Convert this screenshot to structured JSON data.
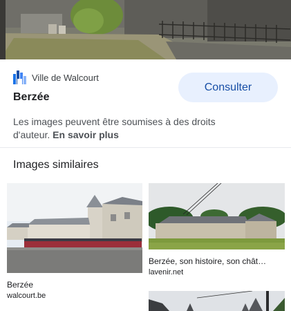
{
  "source": {
    "name": "Ville de Walcourt",
    "logo_icon": "walcourt-logo-icon",
    "brand_color": "#1a73e8"
  },
  "image": {
    "title": "Berzée",
    "consult_label": "Consulter",
    "notice_text": "Les images peuvent être soumises à des droits d'auteur.",
    "learn_more": "En savoir plus"
  },
  "similar": {
    "heading": "Images similaires",
    "items": [
      {
        "caption": "Berzée",
        "domain": "walcourt.be"
      },
      {
        "caption": "Berzée, son histoire, son chât…",
        "domain": "lavenir.net"
      },
      {
        "caption": "",
        "domain": ""
      }
    ]
  },
  "colors": {
    "button_bg": "#e8f0fe",
    "button_text": "#174ea6",
    "divider": "#e8eaed"
  }
}
